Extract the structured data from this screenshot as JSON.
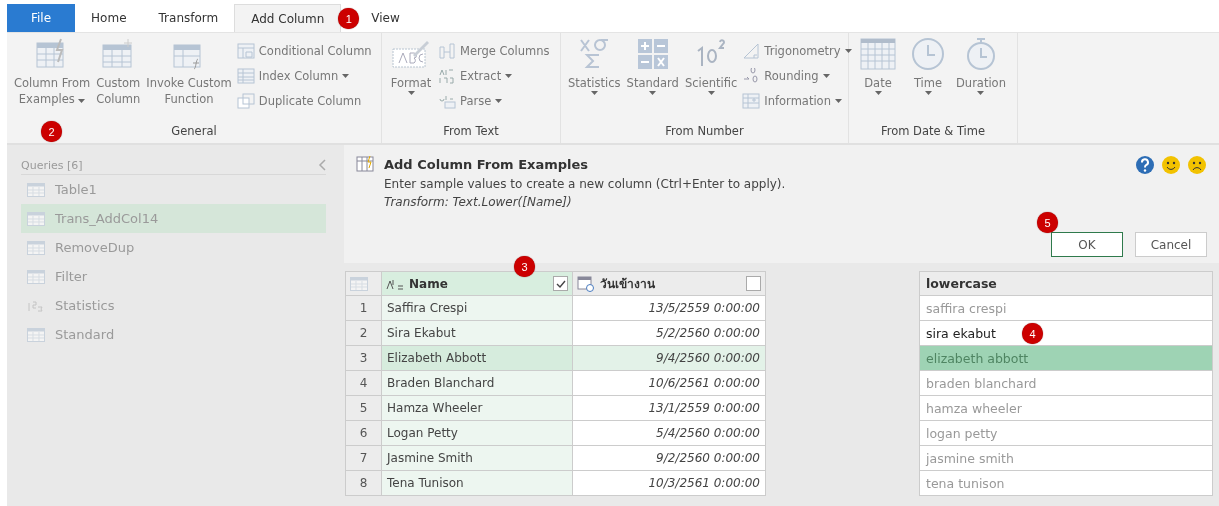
{
  "tabs": [
    {
      "label": "File",
      "selected": false,
      "kind": "file"
    },
    {
      "label": "Home",
      "selected": false
    },
    {
      "label": "Transform",
      "selected": false
    },
    {
      "label": "Add Column",
      "selected": true,
      "callout": "1"
    },
    {
      "label": "View",
      "selected": false
    }
  ],
  "ribbon_groups": [
    {
      "label": "General",
      "items": [
        {
          "kind": "large",
          "lines": [
            "Column From",
            "Examples"
          ],
          "dropdown": true,
          "callout": "2"
        },
        {
          "kind": "large",
          "lines": [
            "Custom",
            "Column"
          ],
          "dropdown": false
        },
        {
          "kind": "large",
          "lines": [
            "Invoke Custom",
            "Function"
          ],
          "dropdown": false
        },
        {
          "kind": "small",
          "lines": [
            "Conditional Column"
          ],
          "dropdown": false
        },
        {
          "kind": "small",
          "lines": [
            "Index Column"
          ],
          "dropdown": true
        },
        {
          "kind": "small",
          "lines": [
            "Duplicate Column"
          ],
          "dropdown": false
        }
      ]
    },
    {
      "label": "From Text",
      "items": [
        {
          "kind": "large",
          "lines": [
            "Format"
          ],
          "dropdown": true
        },
        {
          "kind": "small",
          "lines": [
            "Merge Columns"
          ],
          "dropdown": false
        },
        {
          "kind": "small",
          "lines": [
            "Extract"
          ],
          "dropdown": true
        },
        {
          "kind": "small",
          "lines": [
            "Parse"
          ],
          "dropdown": true
        }
      ]
    },
    {
      "label": "From Number",
      "items": [
        {
          "kind": "large",
          "lines": [
            "Statistics"
          ],
          "dropdown": true
        },
        {
          "kind": "large",
          "lines": [
            "Standard"
          ],
          "dropdown": true
        },
        {
          "kind": "large",
          "lines": [
            "Scientific"
          ],
          "dropdown": true
        },
        {
          "kind": "small",
          "lines": [
            "Trigonometry"
          ],
          "dropdown": true
        },
        {
          "kind": "small",
          "lines": [
            "Rounding"
          ],
          "dropdown": true
        },
        {
          "kind": "small",
          "lines": [
            "Information"
          ],
          "dropdown": true
        }
      ]
    },
    {
      "label": "From Date & Time",
      "items": [
        {
          "kind": "large",
          "lines": [
            "Date"
          ],
          "dropdown": true
        },
        {
          "kind": "large",
          "lines": [
            "Time"
          ],
          "dropdown": true
        },
        {
          "kind": "large",
          "lines": [
            "Duration"
          ],
          "dropdown": true
        }
      ]
    }
  ],
  "queries": {
    "title": "Queries [6]",
    "items": [
      {
        "label": "Table1",
        "kind": "table",
        "selected": false
      },
      {
        "label": "Trans_AddCol14",
        "kind": "table",
        "selected": true
      },
      {
        "label": "RemoveDup",
        "kind": "table",
        "selected": false
      },
      {
        "label": "Filter",
        "kind": "table",
        "selected": false
      },
      {
        "label": "Statistics",
        "kind": "number",
        "selected": false
      },
      {
        "label": "Standard",
        "kind": "table",
        "selected": false
      }
    ]
  },
  "dialog": {
    "title": "Add Column From Examples",
    "description": "Enter sample values to create a new column (Ctrl+Enter to apply).",
    "transform": "Transform: Text.Lower([Name])",
    "ok": "OK",
    "ok_callout": "5",
    "cancel": "Cancel"
  },
  "table": {
    "columns": [
      {
        "label": "Name",
        "kind": "text",
        "checked": true,
        "callout": "3"
      },
      {
        "label": "วันเข้างาน",
        "kind": "datetime",
        "checked": false
      }
    ],
    "rows": [
      {
        "index": "1",
        "name": "Saffira Crespi",
        "date": "13/5/2559 0:00:00",
        "selected": false
      },
      {
        "index": "2",
        "name": "Sira Ekabut",
        "date": "5/2/2560 0:00:00",
        "selected": false
      },
      {
        "index": "3",
        "name": "Elizabeth Abbott",
        "date": "9/4/2560 0:00:00",
        "selected": true
      },
      {
        "index": "4",
        "name": "Braden Blanchard",
        "date": "10/6/2561 0:00:00",
        "selected": false
      },
      {
        "index": "5",
        "name": "Hamza Wheeler",
        "date": "13/1/2559 0:00:00",
        "selected": false
      },
      {
        "index": "6",
        "name": "Logan Petty",
        "date": "5/4/2560 0:00:00",
        "selected": false
      },
      {
        "index": "7",
        "name": "Jasmine Smith",
        "date": "9/2/2560 0:00:00",
        "selected": false
      },
      {
        "index": "8",
        "name": "Tena Tunison",
        "date": "10/3/2561 0:00:00",
        "selected": false
      }
    ]
  },
  "examples": {
    "header": "lowercase",
    "rows": [
      {
        "text": "saffira crespi",
        "kind": "suggested",
        "selected": false
      },
      {
        "text": "sira ekabut",
        "kind": "entered",
        "selected": false,
        "callout": "4"
      },
      {
        "text": "elizabeth abbott",
        "kind": "suggested",
        "selected": true
      },
      {
        "text": "braden blanchard",
        "kind": "suggested",
        "selected": false
      },
      {
        "text": "hamza wheeler",
        "kind": "suggested",
        "selected": false
      },
      {
        "text": "logan petty",
        "kind": "suggested",
        "selected": false
      },
      {
        "text": "jasmine smith",
        "kind": "suggested",
        "selected": false
      },
      {
        "text": "tena tunison",
        "kind": "suggested",
        "selected": false
      }
    ]
  }
}
